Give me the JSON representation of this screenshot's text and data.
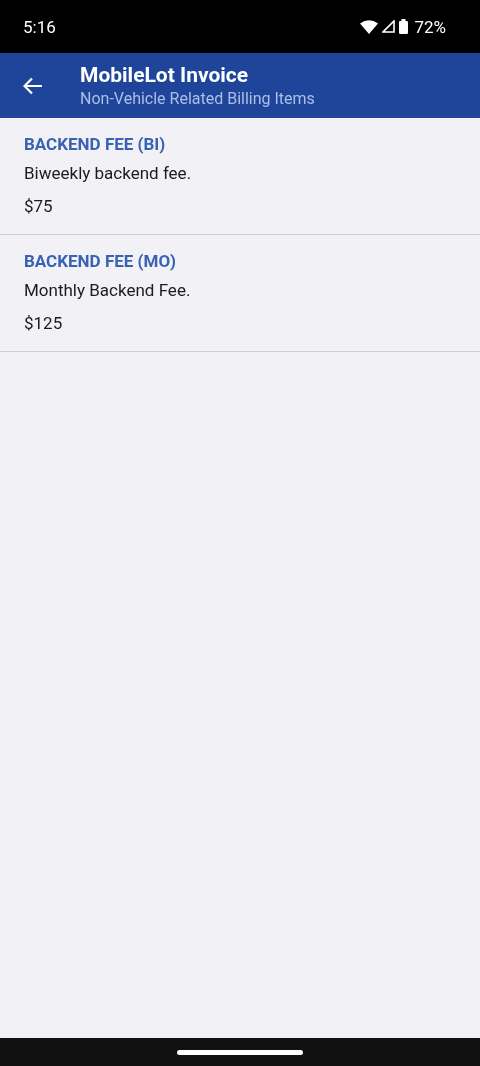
{
  "status_bar": {
    "time": "5:16",
    "battery": "72%"
  },
  "app_bar": {
    "title": "MobileLot Invoice",
    "subtitle": "Non-Vehicle Related Billing Items"
  },
  "items": [
    {
      "name": "BACKEND FEE (BI)",
      "description": "Biweekly backend fee.",
      "price": "$75"
    },
    {
      "name": "BACKEND FEE (MO)",
      "description": "Monthly Backend Fee.",
      "price": "$125"
    }
  ]
}
